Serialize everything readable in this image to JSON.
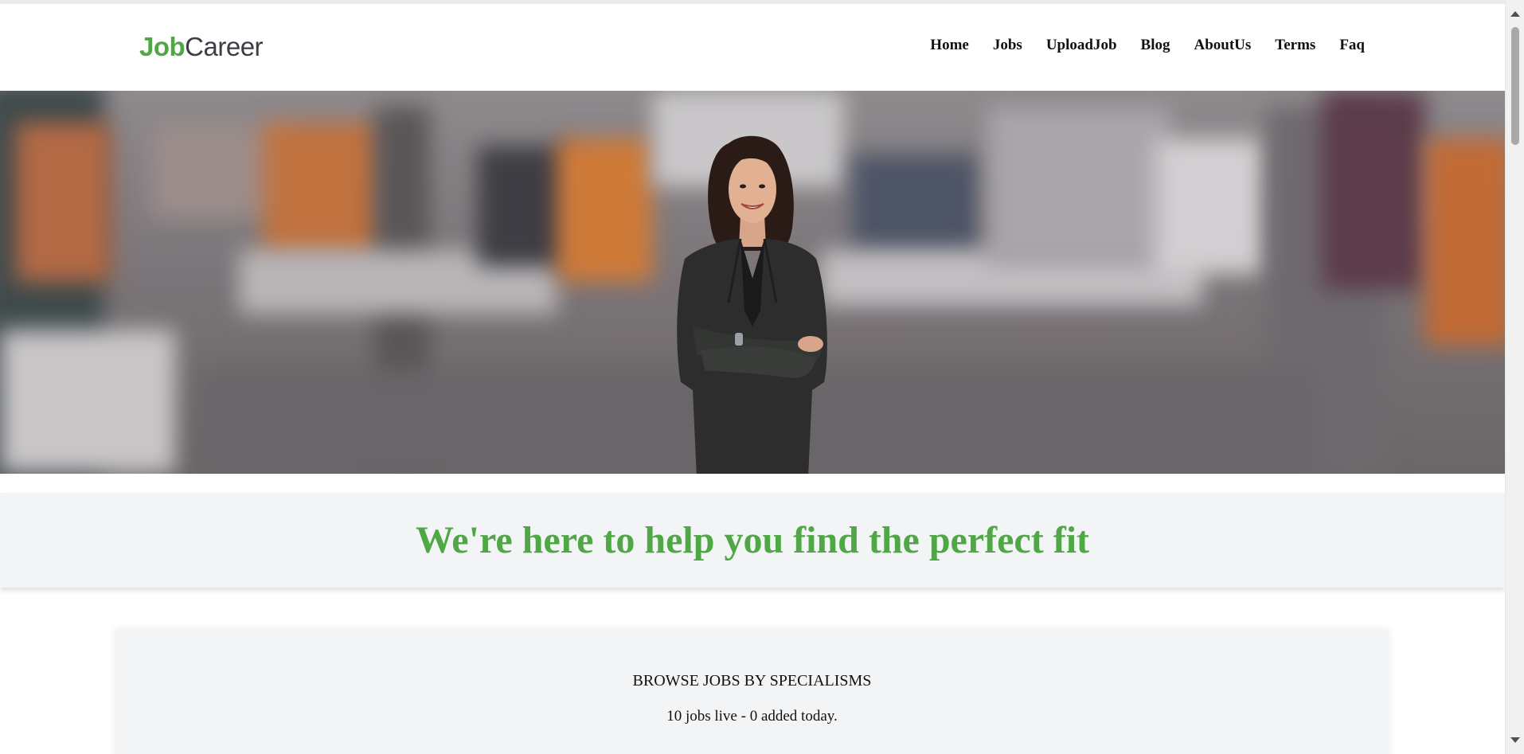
{
  "header": {
    "logo": {
      "part1": "Job",
      "part2": "Career"
    },
    "nav": [
      {
        "label": "Home"
      },
      {
        "label": "Jobs"
      },
      {
        "label": "UploadJob"
      },
      {
        "label": "Blog"
      },
      {
        "label": "AboutUs"
      },
      {
        "label": "Terms"
      },
      {
        "label": "Faq"
      }
    ]
  },
  "hero": {
    "image": "smiling-businesswoman-arms-crossed-office"
  },
  "tagline": {
    "text": "We're here to help you find the perfect fit"
  },
  "browse": {
    "title": "BROWSE JOBS BY SPECIALISMS",
    "stats": "10 jobs live - 0 added today."
  },
  "colors": {
    "brand_green": "#4fa746",
    "logo_dark": "#3b3f45",
    "band_bg": "#f3f4f6"
  }
}
